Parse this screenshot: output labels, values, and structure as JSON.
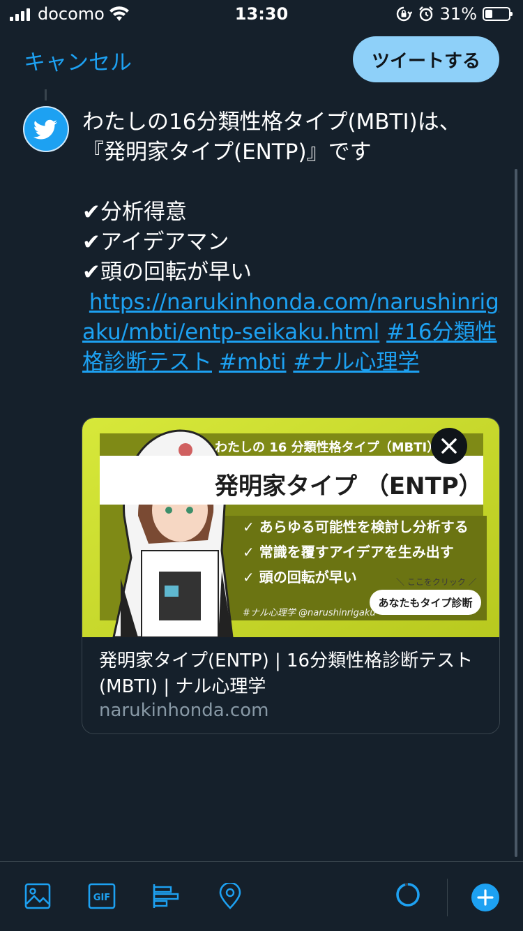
{
  "status_bar": {
    "carrier": "docomo",
    "time": "13:30",
    "battery_percent": "31%"
  },
  "header": {
    "cancel_label": "キャンセル",
    "tweet_button_label": "ツイートする"
  },
  "tweet": {
    "line1": "わたしの16分類性格タイプ(MBTI)は、",
    "line2": "『発明家タイプ(ENTP)』です",
    "bullet1": "✔分析得意",
    "bullet2": "✔アイデアマン",
    "bullet3": "✔頭の回転が早い",
    "url": "https://narukinhonda.com/narushinrigaku/mbti/entp-seikaku.html",
    "hashtag1": "#16分類性格診断テスト",
    "hashtag2": "#mbti",
    "hashtag3": "#ナル心理学"
  },
  "card": {
    "title": "発明家タイプ(ENTP) | 16分類性格診断テスト(MBTI) | ナル心理学",
    "domain": "narukinhonda.com",
    "image": {
      "headline": "わたしの 16 分類性格タイプ（MBTI）は…",
      "type_name": "発明家タイプ （ENTP）",
      "bullets": [
        "✓ あらゆる可能性を検討し分析する",
        "✓ 常識を覆すアイデアを生み出す",
        "✓ 頭の回転が早い"
      ],
      "click_hint": "＼ ここをクリック ／",
      "button_label": "あなたもタイプ診断",
      "hashtag_line": "#ナル心理学 @narushinrigaku"
    }
  },
  "colors": {
    "background": "#15202b",
    "accent": "#1da1f2",
    "tweet_button": "#8ed0f9",
    "border": "#38444d",
    "secondary_text": "#8899a6",
    "banner_yellow": "#c7d82a"
  },
  "toolbar": {
    "icons": [
      "image-icon",
      "gif-icon",
      "poll-icon",
      "location-icon",
      "character-counter-icon",
      "add-tweet-icon"
    ]
  }
}
